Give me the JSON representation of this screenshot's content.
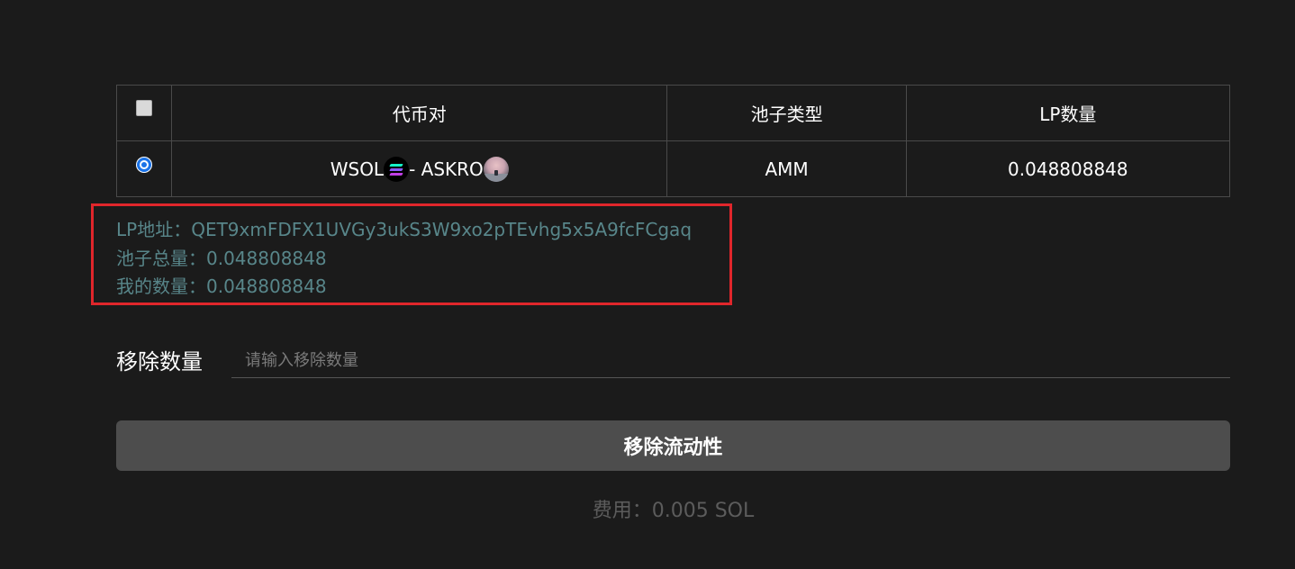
{
  "table": {
    "headers": {
      "pair": "代币对",
      "pool_type": "池子类型",
      "lp_amount": "LP数量"
    },
    "rows": [
      {
        "selected": true,
        "token_a": "WSOL",
        "separator": "- ",
        "token_b": "ASKRO",
        "pool_type": "AMM",
        "lp_amount": "0.048808848"
      }
    ]
  },
  "info": {
    "lp_address": "LP地址：QET9xmFDFX1UVGy3ukS3W9xo2pTEvhg5x5A9fcFCgaq",
    "pool_total": "池子总量：0.048808848",
    "my_amount": "我的数量：0.048808848",
    "highlight_color": "#e0262b",
    "text_color": "#58868a"
  },
  "remove": {
    "label": "移除数量",
    "placeholder": "请输入移除数量",
    "value": ""
  },
  "button": {
    "label": "移除流动性"
  },
  "fee": {
    "text": "费用：0.005 SOL"
  },
  "icons": {
    "token_a": "solana-icon",
    "token_b": "askro-token-icon"
  },
  "colors": {
    "background": "#1b1b1b",
    "button": "#4d4d4d",
    "radio_accent": "#1a73e8"
  }
}
